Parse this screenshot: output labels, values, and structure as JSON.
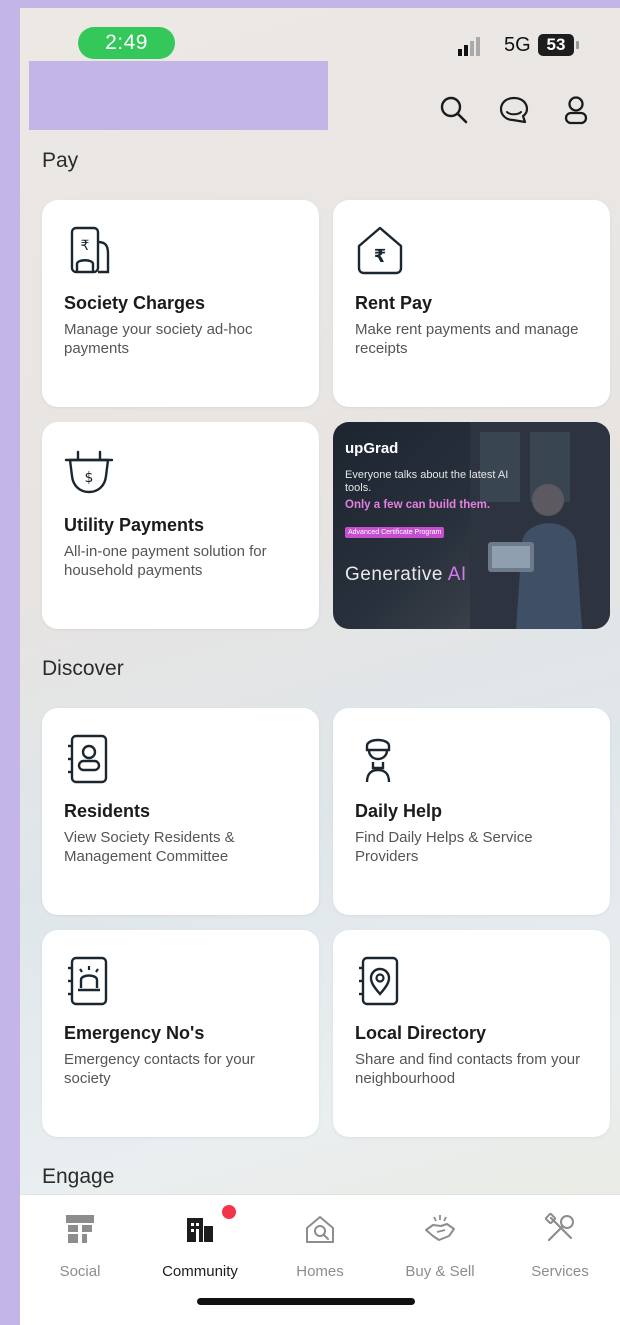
{
  "status_bar": {
    "time": "2:49",
    "network": "5G",
    "battery": "53"
  },
  "header": {
    "icons": [
      "search-icon",
      "chat-icon",
      "profile-icon"
    ]
  },
  "sections": {
    "pay": {
      "title": "Pay",
      "cards": [
        {
          "title": "Society Charges",
          "desc": "Manage your society ad-hoc payments",
          "icon": "society-charges-icon"
        },
        {
          "title": "Rent Pay",
          "desc": "Make rent payments and manage receipts",
          "icon": "rent-pay-icon"
        },
        {
          "title": "Utility Payments",
          "desc": "All-in-one payment solution for household payments",
          "icon": "utility-payments-icon"
        }
      ]
    },
    "discover": {
      "title": "Discover",
      "cards": [
        {
          "title": "Residents",
          "desc": "View Society Residents & Management Committee",
          "icon": "residents-icon"
        },
        {
          "title": "Daily Help",
          "desc": "Find Daily Helps & Service Providers",
          "icon": "daily-help-icon"
        },
        {
          "title": "Emergency No's",
          "desc": "Emergency contacts for your society",
          "icon": "emergency-icon"
        },
        {
          "title": "Local Directory",
          "desc": "Share and find contacts from your neighbourhood",
          "icon": "local-directory-icon"
        }
      ]
    },
    "engage": {
      "title": "Engage"
    }
  },
  "promo": {
    "brand": "upGrad",
    "line1": "Everyone talks about the latest AI tools.",
    "line2": "Only a few can build them.",
    "tag": "Advanced Certificate Program",
    "headline_main": "Generative",
    "headline_accent": "AI"
  },
  "bottom_nav": {
    "items": [
      {
        "label": "Social",
        "icon": "social-icon"
      },
      {
        "label": "Community",
        "icon": "community-icon",
        "active": true
      },
      {
        "label": "Homes",
        "icon": "homes-icon"
      },
      {
        "label": "Buy & Sell",
        "icon": "buy-sell-icon"
      },
      {
        "label": "Services",
        "icon": "services-icon"
      }
    ]
  },
  "colors": {
    "accent_green": "#34c759",
    "notification": "#f2364a",
    "card_bg": "#ffffff",
    "brand_block": "#c3b5e6"
  }
}
